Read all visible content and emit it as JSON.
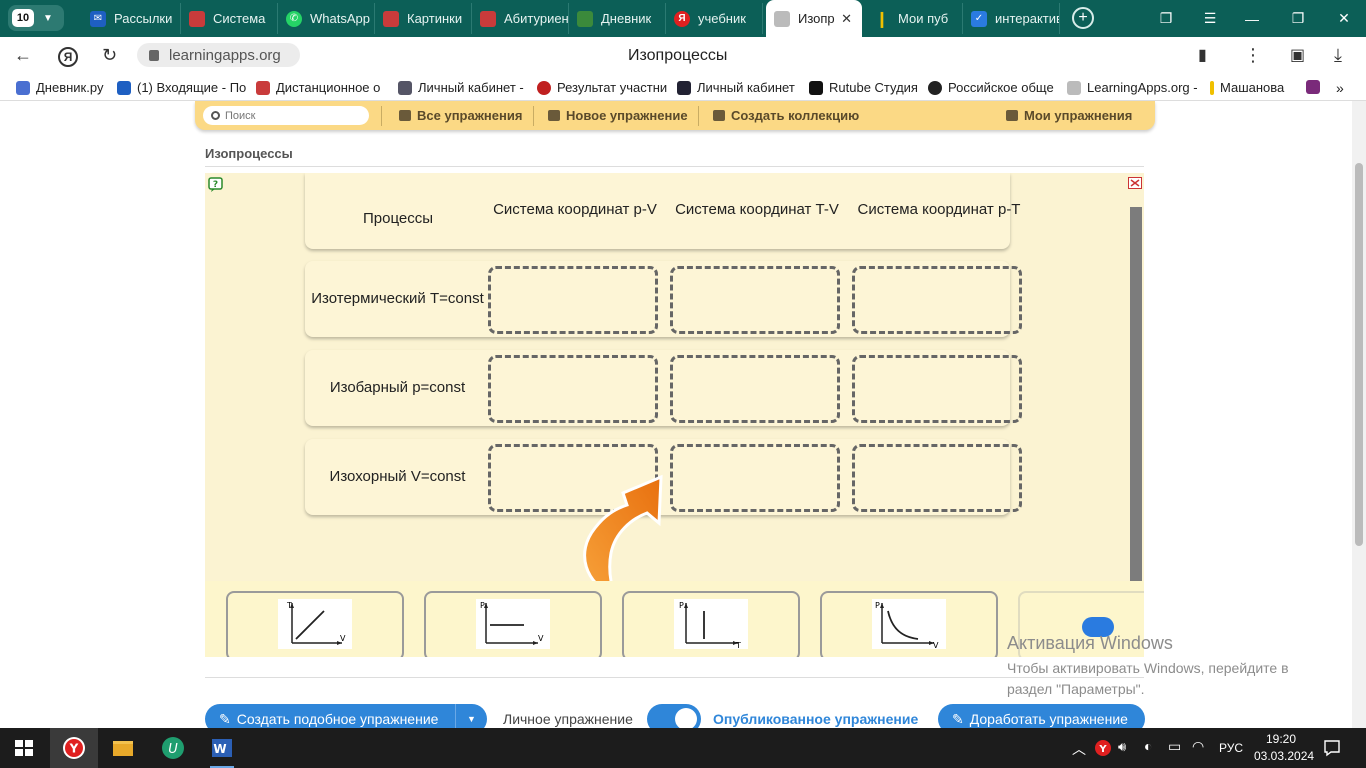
{
  "browser": {
    "tab_count": "10",
    "tabs": [
      {
        "label": "Рассылки",
        "color": "#1e5fc2"
      },
      {
        "label": "Система",
        "color": "#c93b3b"
      },
      {
        "label": "WhatsApp",
        "color": "#25d366"
      },
      {
        "label": "Картинки",
        "color": "#c93b3b"
      },
      {
        "label": "Абитуриент",
        "color": "#c93b3b"
      },
      {
        "label": "Дневник",
        "color": "#3b8a3b"
      },
      {
        "label": "учебник",
        "color": "#e02020"
      },
      {
        "label": "Изопр",
        "color": "#999999"
      },
      {
        "label": "Мои пуб",
        "color": "#f0c000"
      },
      {
        "label": "интерактив",
        "color": "#2a7be0"
      }
    ],
    "url": "learningapps.org",
    "page_title": "Изопроцессы",
    "bookmarks": [
      "Дневник.ру",
      "(1) Входящие - По",
      "Дистанционное о",
      "Личный кабинет -",
      "Результат участни",
      "Личный кабинет",
      "Rutube Студия",
      "Российское обще",
      "LearningApps.org -",
      "Машанова"
    ]
  },
  "toolbar": {
    "search_placeholder": "Поиск",
    "all_exercises": "Все упражнения",
    "new_exercise": "Новое упражнение",
    "create_collection": "Создать коллекцию",
    "my_exercises": "Мои упражнения"
  },
  "exercise": {
    "title": "Изопроцессы",
    "header": {
      "processes": "Процессы",
      "pv": "Система координат p-V",
      "tv": "Система координат T-V",
      "pt": "Система координат p-T"
    },
    "rows": [
      {
        "label": "Изотермический T=const"
      },
      {
        "label": "Изобарный p=const"
      },
      {
        "label": "Изохорный V=const"
      }
    ],
    "cards": [
      {
        "y_axis": "T",
        "x_axis": "V"
      },
      {
        "y_axis": "P",
        "x_axis": "V"
      },
      {
        "y_axis": "P",
        "x_axis": "T"
      },
      {
        "y_axis": "P",
        "x_axis": "V"
      }
    ]
  },
  "footer": {
    "create_similar": "Создать подобное упражнение",
    "private_label": "Личное упражнение",
    "published_label": "Опубликованное упражнение",
    "improve": "Доработать упражнение"
  },
  "watermark": {
    "title": "Активация Windows",
    "text": "Чтобы активировать Windows, перейдите в раздел \"Параметры\"."
  },
  "taskbar": {
    "lang": "РУС",
    "time": "19:20",
    "date": "03.03.2024"
  }
}
